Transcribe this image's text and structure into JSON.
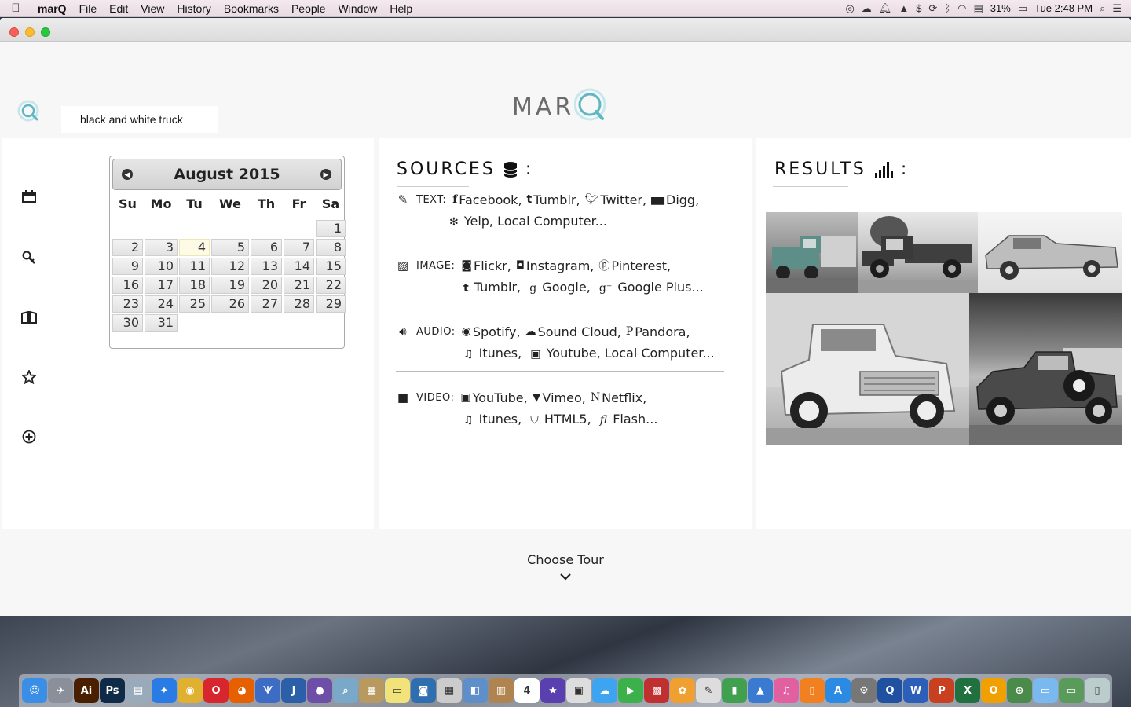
{
  "menubar": {
    "apple_glyph": "",
    "app_name": "marQ",
    "items": [
      "File",
      "Edit",
      "View",
      "History",
      "Bookmarks",
      "People",
      "Window",
      "Help"
    ],
    "battery": "31%",
    "clock": "Tue 2:48 PM"
  },
  "header": {
    "search_value": "black and white truck",
    "logo_text": "MAR"
  },
  "calendar": {
    "title": "August 2015",
    "weekdays": [
      "Su",
      "Mo",
      "Tu",
      "We",
      "Th",
      "Fr",
      "Sa"
    ],
    "days": [
      "1",
      "2",
      "3",
      "4",
      "5",
      "6",
      "7",
      "8",
      "9",
      "10",
      "11",
      "12",
      "13",
      "14",
      "15",
      "16",
      "17",
      "18",
      "19",
      "20",
      "21",
      "22",
      "23",
      "24",
      "25",
      "26",
      "27",
      "28",
      "29",
      "30",
      "31"
    ],
    "first_weekday_index": 6,
    "today": "4"
  },
  "sources": {
    "title": "SOURCES",
    "colon": ":",
    "text": {
      "label": "TEXT:",
      "line1": [
        "Facebook,",
        "Tumblr,",
        "Twitter,",
        "Digg,"
      ],
      "line2": [
        "Yelp, Local Computer..."
      ]
    },
    "image": {
      "label": "IMAGE:",
      "line1": [
        "Flickr,",
        "Instagram,",
        "Pinterest,"
      ],
      "line2": [
        "Tumblr,",
        "Google,",
        "Google Plus..."
      ]
    },
    "audio": {
      "label": "AUDIO:",
      "line1": [
        "Spotify,",
        "Sound Cloud,",
        "Pandora,"
      ],
      "line2": [
        "Itunes,",
        "Youtube, Local Computer..."
      ]
    },
    "video": {
      "label": "VIDEO:",
      "line1": [
        "YouTube,",
        "Vimeo,",
        "Netflix,"
      ],
      "line2": [
        "Itunes,",
        "HTML5,",
        "Flash..."
      ]
    }
  },
  "results": {
    "title": "RESULTS",
    "colon": ":"
  },
  "tour": {
    "label": "Choose Tour"
  },
  "colors": {
    "accent_teal": "#5fb7c4",
    "panel_bg": "#ffffff",
    "page_bg": "#f7f7f7"
  }
}
